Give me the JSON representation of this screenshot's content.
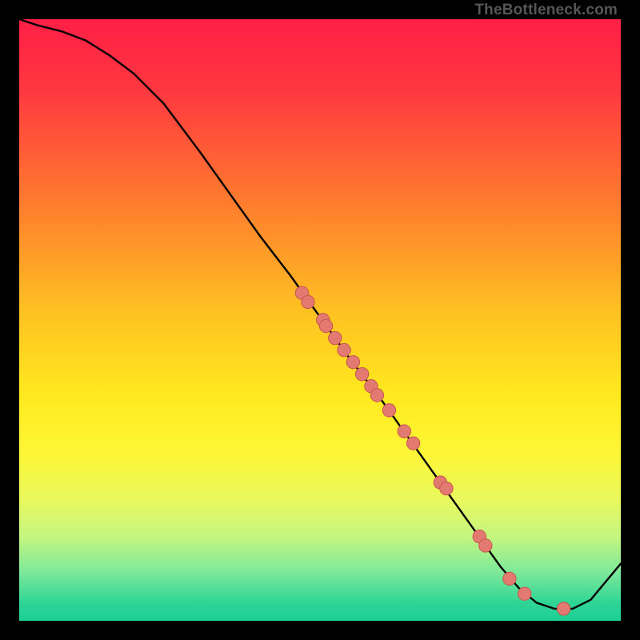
{
  "watermark": "TheBottleneck.com",
  "colors": {
    "background": "#000000",
    "gradient_stops": [
      {
        "offset": 0.0,
        "color": "#ff1f46"
      },
      {
        "offset": 0.12,
        "color": "#ff3840"
      },
      {
        "offset": 0.3,
        "color": "#ff7a2e"
      },
      {
        "offset": 0.48,
        "color": "#ffbf22"
      },
      {
        "offset": 0.62,
        "color": "#ffe81e"
      },
      {
        "offset": 0.72,
        "color": "#fdf635"
      },
      {
        "offset": 0.8,
        "color": "#e9f85e"
      },
      {
        "offset": 0.86,
        "color": "#c4f67f"
      },
      {
        "offset": 0.92,
        "color": "#7ce99a"
      },
      {
        "offset": 0.97,
        "color": "#30d596"
      },
      {
        "offset": 1.0,
        "color": "#1ccf93"
      }
    ],
    "curve": "#000000",
    "marker_fill": "#e27a72",
    "marker_stroke": "#c9564e"
  },
  "chart_data": {
    "type": "line",
    "title": "",
    "xlabel": "",
    "ylabel": "",
    "xlim": [
      0,
      100
    ],
    "ylim": [
      0,
      100
    ],
    "series": [
      {
        "name": "curve",
        "x": [
          0,
          3,
          7,
          11,
          15,
          19,
          24,
          30,
          35,
          40,
          45,
          50,
          55,
          60,
          65,
          70,
          75,
          80,
          83,
          86,
          89,
          92,
          95,
          100
        ],
        "y": [
          100,
          99,
          98,
          96.5,
          94,
          91,
          86,
          78,
          71,
          64,
          57.5,
          50.5,
          43.5,
          37,
          30,
          23,
          16,
          9,
          5.5,
          3,
          2,
          2,
          3.5,
          9.5
        ]
      }
    ],
    "markers": [
      {
        "x": 47.0,
        "y": 54.5
      },
      {
        "x": 48.0,
        "y": 53.0
      },
      {
        "x": 50.5,
        "y": 50.0
      },
      {
        "x": 51.0,
        "y": 49.0
      },
      {
        "x": 52.5,
        "y": 47.0
      },
      {
        "x": 54.0,
        "y": 45.0
      },
      {
        "x": 55.5,
        "y": 43.0
      },
      {
        "x": 57.0,
        "y": 41.0
      },
      {
        "x": 58.5,
        "y": 39.0
      },
      {
        "x": 59.5,
        "y": 37.5
      },
      {
        "x": 61.5,
        "y": 35.0
      },
      {
        "x": 64.0,
        "y": 31.5
      },
      {
        "x": 65.5,
        "y": 29.5
      },
      {
        "x": 70.0,
        "y": 23.0
      },
      {
        "x": 71.0,
        "y": 22.0
      },
      {
        "x": 76.5,
        "y": 14.0
      },
      {
        "x": 77.5,
        "y": 12.5
      },
      {
        "x": 81.5,
        "y": 7.0
      },
      {
        "x": 84.0,
        "y": 4.5
      },
      {
        "x": 90.5,
        "y": 2.0
      }
    ]
  }
}
